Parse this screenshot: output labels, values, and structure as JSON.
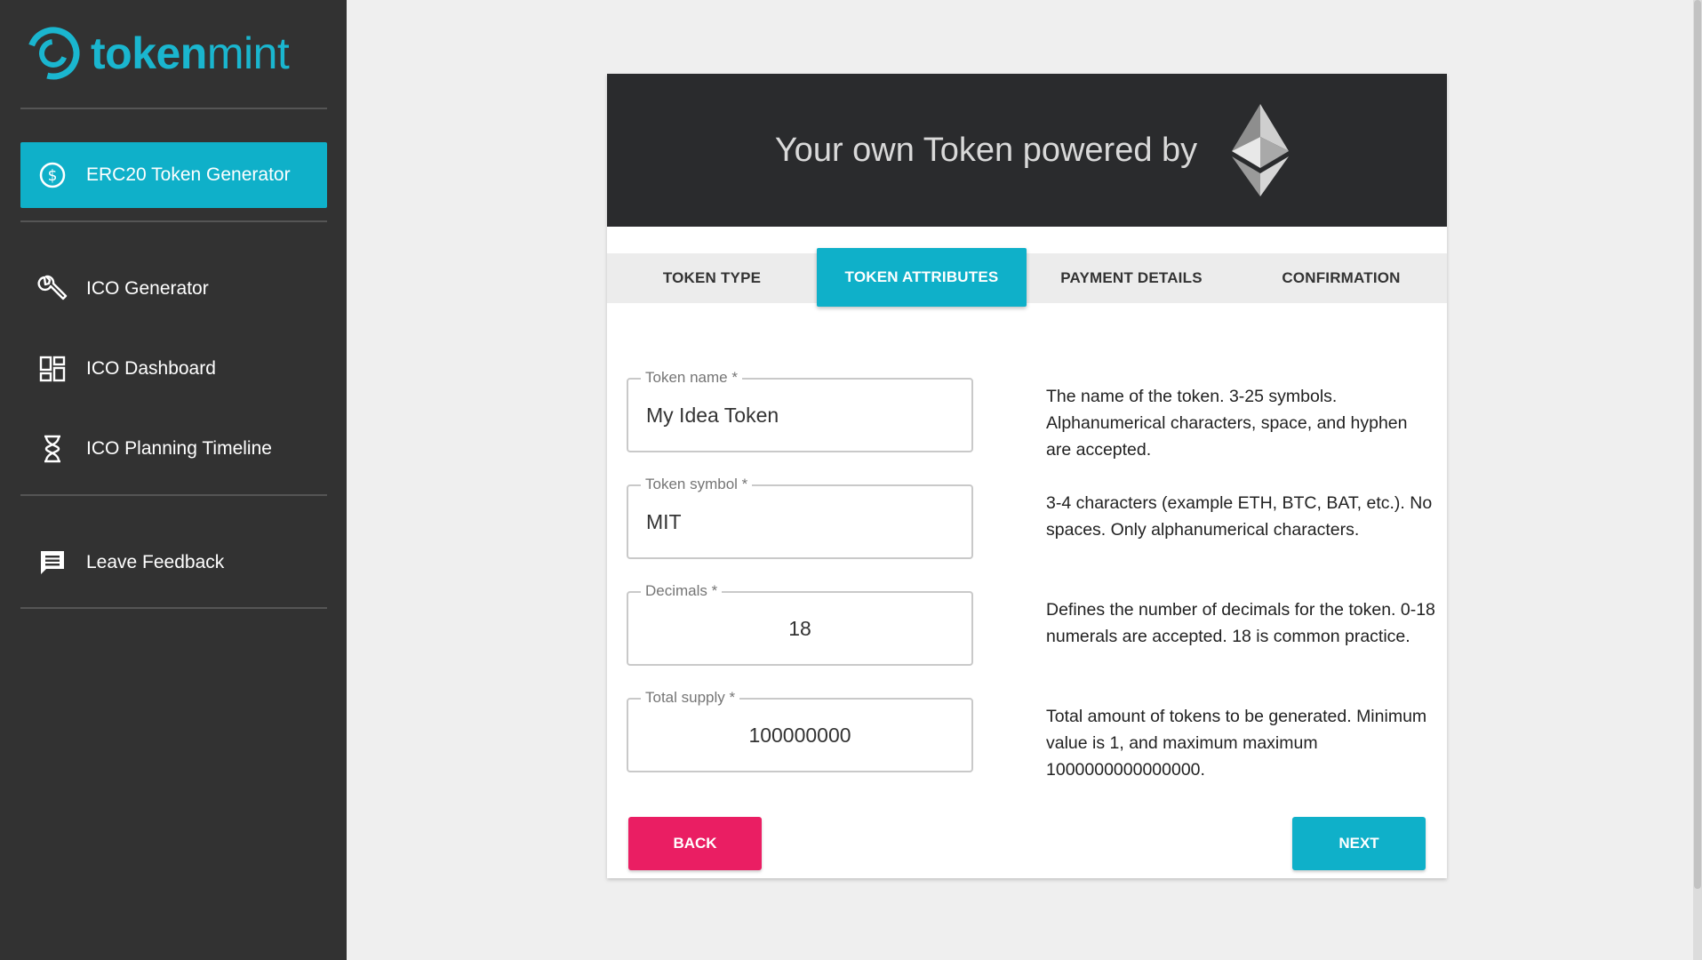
{
  "brand": {
    "bold": "token",
    "thin": "mint"
  },
  "sidebar": {
    "items": [
      {
        "label": "ERC20 Token Generator",
        "icon": "dollar-circle-icon"
      },
      {
        "label": "ICO Generator",
        "icon": "wrench-icon"
      },
      {
        "label": "ICO Dashboard",
        "icon": "dashboard-icon"
      },
      {
        "label": "ICO Planning Timeline",
        "icon": "hourglass-icon"
      },
      {
        "label": "Leave Feedback",
        "icon": "feedback-icon"
      }
    ]
  },
  "hero": {
    "title": "Your own Token powered by",
    "icon": "ethereum-icon"
  },
  "steps": [
    {
      "label": "TOKEN TYPE"
    },
    {
      "label": "TOKEN ATTRIBUTES"
    },
    {
      "label": "PAYMENT DETAILS"
    },
    {
      "label": "CONFIRMATION"
    }
  ],
  "form": {
    "token_name": {
      "label": "Token name *",
      "value": "My Idea Token",
      "help": "The name of the token. 3-25 symbols. Alphanumerical characters, space, and hyphen are accepted."
    },
    "token_symbol": {
      "label": "Token symbol *",
      "value": "MIT",
      "help": "3-4 characters (example ETH, BTC, BAT, etc.). No spaces. Only alphanumerical characters."
    },
    "decimals": {
      "label": "Decimals *",
      "value": "18",
      "help": "Defines the number of decimals for the token. 0-18 numerals are accepted. 18 is common practice."
    },
    "total_supply": {
      "label": "Total supply *",
      "value": "100000000",
      "help": "Total amount of tokens to be generated. Minimum value is 1, and maximum maximum 1000000000000000."
    }
  },
  "buttons": {
    "back": "BACK",
    "next": "NEXT"
  },
  "colors": {
    "accent": "#0fb0c9",
    "brand": "#1ab6cf",
    "back_button": "#ea1e63",
    "sidebar_bg": "#323232",
    "hero_bg": "#2a2b2d"
  }
}
